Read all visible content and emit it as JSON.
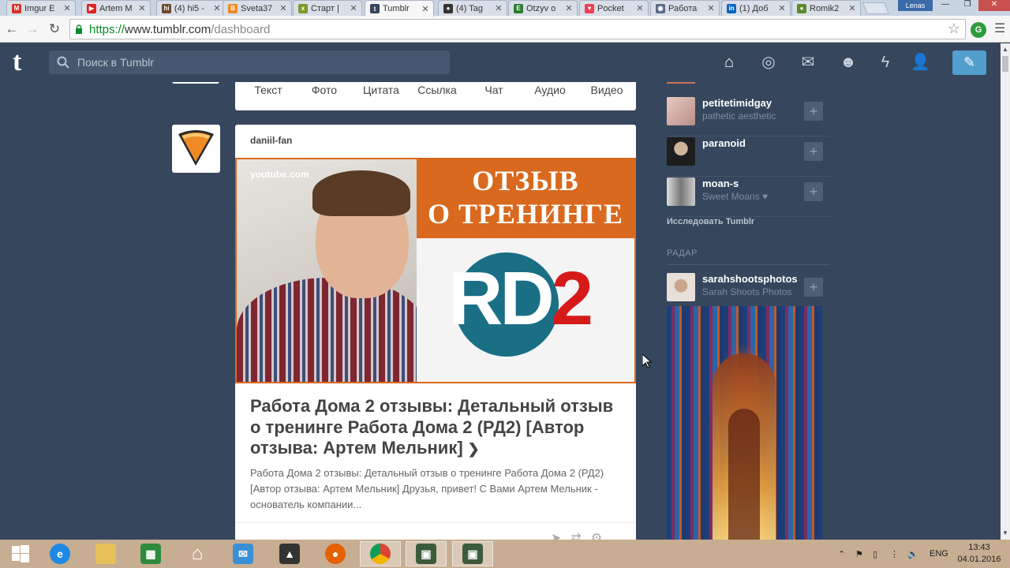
{
  "browser": {
    "tabs": [
      {
        "label": "Imgur E",
        "icon": "gmail-icon",
        "color": "#d93025",
        "glyph": "M"
      },
      {
        "label": "Artem M",
        "icon": "youtube-icon",
        "color": "#e02020",
        "glyph": "▶"
      },
      {
        "label": "(4) hi5 -",
        "icon": "hi5-icon",
        "color": "#6b4a2a",
        "glyph": "hi"
      },
      {
        "label": "Sveta37",
        "icon": "blogger-icon",
        "color": "#f08a24",
        "glyph": "B"
      },
      {
        "label": "Старт |",
        "icon": "xing-icon",
        "color": "#7a9a2a",
        "glyph": "x"
      },
      {
        "label": "Tumblr",
        "icon": "tumblr-icon",
        "color": "#36465d",
        "glyph": "t"
      },
      {
        "label": "(4) Tag",
        "icon": "tagged-icon",
        "color": "#333333",
        "glyph": "●"
      },
      {
        "label": "Otzyv o",
        "icon": "evernote-icon",
        "color": "#2e7d32",
        "glyph": "E"
      },
      {
        "label": "Pocket",
        "icon": "pocket-icon",
        "color": "#ef4056",
        "glyph": "♥"
      },
      {
        "label": "Работа",
        "icon": "person-icon",
        "color": "#5a6b8c",
        "glyph": "◉"
      },
      {
        "label": "(1) Доб",
        "icon": "linkedin-icon",
        "color": "#0a66c2",
        "glyph": "in"
      },
      {
        "label": "Romik2",
        "icon": "green-icon",
        "color": "#5b8a2a",
        "glyph": "●"
      }
    ],
    "active_tab_index": 5,
    "user_badge": "Lenas",
    "url_scheme": "https://",
    "url_host": "www.tumblr.com",
    "url_path": "/dashboard",
    "extension_glyph": "G"
  },
  "header": {
    "search_placeholder": "Поиск в Tumblr",
    "icons": [
      "home-icon",
      "explore-icon",
      "inbox-icon",
      "messaging-icon",
      "activity-icon",
      "account-icon"
    ],
    "compose_icon": "pencil-icon"
  },
  "post_types": [
    "Текст",
    "Фото",
    "Цитата",
    "Ссылка",
    "Чат",
    "Аудио",
    "Видео"
  ],
  "post": {
    "author": "daniil-fan",
    "source": "youtube.com",
    "banner_line1": "ОТЗЫВ",
    "banner_line2": "О ТРЕНИНГЕ",
    "logo_main": "RD",
    "logo_num": "2",
    "title": "Работа Дома 2 отзывы: Детальный отзыв о тренинге Работа Дома 2 (РД2) [Автор отзыва: Артем Мельник]",
    "body": "Работа Дома 2 отзывы: Детальный отзыв о тренинге Работа Дома 2 (РД2) [Автор отзыва: Артем Мельник] Друзья, привет! С Вами Артем Мельник - основатель компании..."
  },
  "sidebar": {
    "recommended": [
      {
        "name": "petitetimidgay",
        "subtitle": "pathetic aesthetic"
      },
      {
        "name": "paranoid",
        "subtitle": ""
      },
      {
        "name": "moan-s",
        "subtitle": "Sweet Moans ♥"
      }
    ],
    "explore_link": "Исследовать Tumblr",
    "radar_label": "РАДАР",
    "radar": {
      "name": "sarahshootsphotos",
      "subtitle": "Sarah Shoots Photos"
    }
  },
  "taskbar": {
    "lang": "ENG",
    "time": "13:43",
    "date": "04.01.2016"
  }
}
